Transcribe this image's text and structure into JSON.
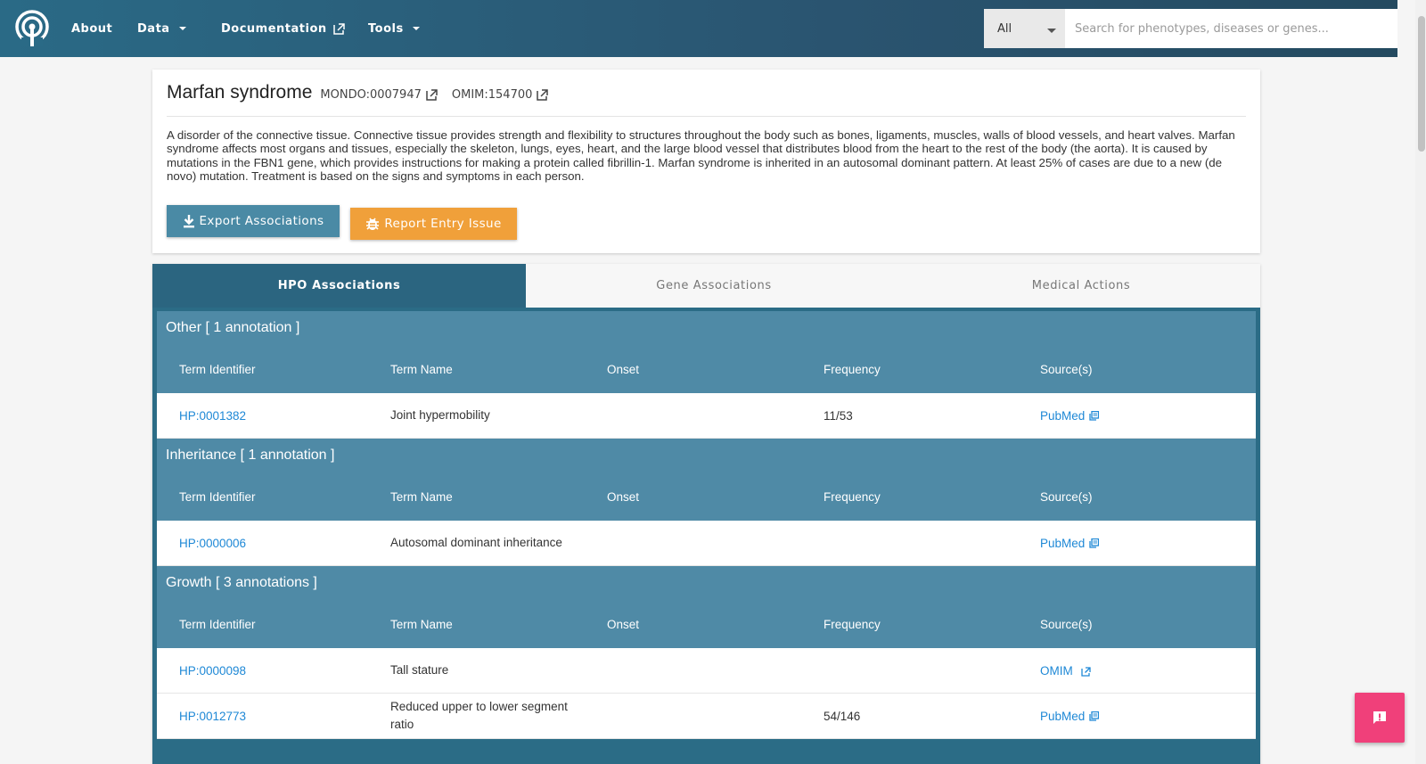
{
  "nav": {
    "about": "About",
    "data": "Data",
    "documentation": "Documentation",
    "tools": "Tools"
  },
  "search": {
    "category": "All",
    "placeholder": "Search for phenotypes, diseases or genes..."
  },
  "disease": {
    "name": "Marfan syndrome",
    "mondo_id": "MONDO:0007947",
    "omim_id": "OMIM:154700",
    "description": "A disorder of the connective tissue. Connective tissue provides strength and flexibility to structures throughout the body such as bones, ligaments, muscles, walls of blood vessels, and heart valves. Marfan syndrome affects most organs and tissues, especially the skeleton, lungs, eyes, heart, and the large blood vessel that distributes blood from the heart to the rest of the body (the aorta). It is caused by mutations in the FBN1 gene, which provides instructions for making a protein called fibrillin-1. Marfan syndrome is inherited in an autosomal dominant pattern. At least 25% of cases are due to a new (de novo) mutation. Treatment is based on the signs and symptoms in each person."
  },
  "actions": {
    "export": "Export Associations",
    "report": "Report Entry Issue"
  },
  "tabs": [
    "HPO Associations",
    "Gene Associations",
    "Medical Actions"
  ],
  "columns": [
    "Term Identifier",
    "Term Name",
    "Onset",
    "Frequency",
    "Source(s)"
  ],
  "groups": [
    {
      "title": "Other [ 1 annotation ]",
      "rows": [
        {
          "id": "HP:0001382",
          "name": "Joint hypermobility",
          "onset": "",
          "frequency": "11/53",
          "source": "PubMed",
          "source_icon": "library-icon"
        }
      ]
    },
    {
      "title": "Inheritance [ 1 annotation ]",
      "rows": [
        {
          "id": "HP:0000006",
          "name": "Autosomal dominant inheritance",
          "onset": "",
          "frequency": "",
          "source": "PubMed",
          "source_icon": "library-icon"
        }
      ]
    },
    {
      "title": "Growth [ 3 annotations ]",
      "rows": [
        {
          "id": "HP:0000098",
          "name": "Tall stature",
          "onset": "",
          "frequency": "",
          "source": "OMIM",
          "source_icon": "external-link-icon"
        },
        {
          "id": "HP:0012773",
          "name": "Reduced upper to lower segment ratio",
          "onset": "",
          "frequency": "54/146",
          "source": "PubMed",
          "source_icon": "library-icon"
        }
      ]
    }
  ],
  "colors": {
    "nav_bg": "#2a5f7a",
    "tab_active": "#2b6580",
    "group_bg": "#4f8aa6",
    "export_button": "#4a8aa5",
    "report_button": "#f0a03a",
    "link": "#1e88d6",
    "fab": "#f0407a"
  }
}
